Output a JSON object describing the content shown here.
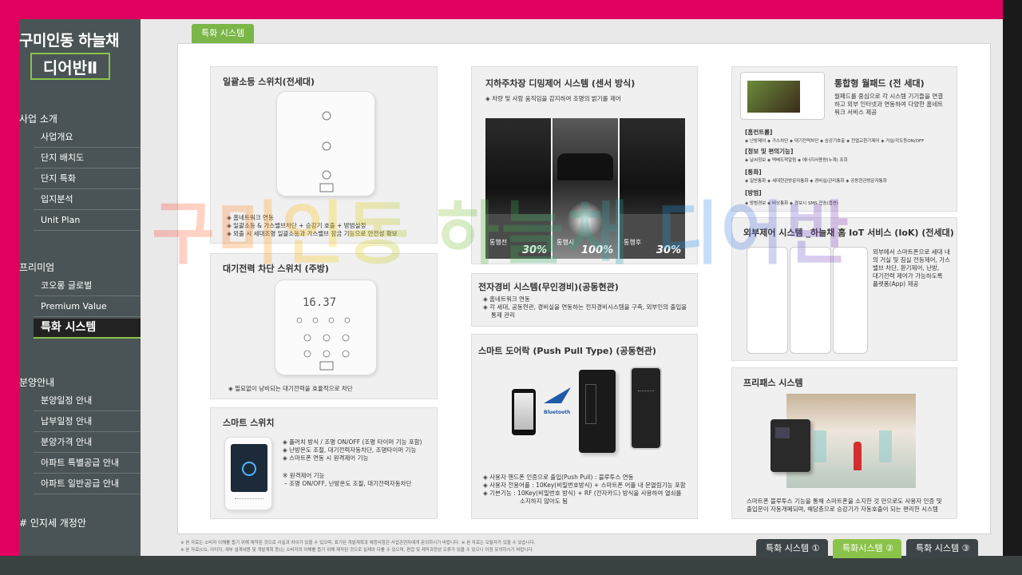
{
  "sidebar": {
    "brand_title": "구미인동 하늘채",
    "brand_sub": "디어반Ⅱ",
    "sections": [
      {
        "title": "사업 소개",
        "items": [
          "사업개요",
          "단지 배치도",
          "단지 특화",
          "입지분석",
          "Unit Plan"
        ]
      },
      {
        "title": "프리미엄",
        "items": [
          "코오롱 글로벌",
          "Premium Value",
          "특화 시스템"
        ]
      },
      {
        "title": "분양안내",
        "items": [
          "분양일정 안내",
          "납부일정 안내",
          "분양가격 안내",
          "아파트 특별공급 안내",
          "아파트 일반공급 안내"
        ]
      },
      {
        "title": "# 인지세 개정안",
        "items": []
      }
    ]
  },
  "tab": {
    "label": "특화 시스템"
  },
  "panels": {
    "light_switch": {
      "title": "일괄소등 스위치(전세대)",
      "lines": [
        "◈ 홈네트워크 연동",
        "◈ 일괄소등 & 가스밸브차단 + 승강기 호출 + 방범설정",
        "◈ 외출 시 세대조명 일괄소등과 가스밸브 잠금 기능으로 안전성 확보"
      ]
    },
    "standby_switch": {
      "title": "대기전력 차단 스위치 (주방)",
      "display": "16.37",
      "lines": [
        "◈ 필요없이 낭비되는 대기전력을 효율적으로 차단"
      ]
    },
    "smart_switch": {
      "title": "스마트 스위치",
      "lines": [
        "◈ 플러치 방식 / 조명 ON/OFF (조명 타이머 기능 포함)",
        "◈ 난방온도 조절, 대기전력자동차단, 조명타이머 기능",
        "◈ 스마트폰 연동 시 원격제어 기능",
        "※ 원격제어 기능",
        "– 조명 ON/OFF, 난방온도 조절, 대기전력자동차단"
      ]
    },
    "parking": {
      "title": "지하주차장 디밍제어 시스템 (센서 방식)",
      "desc": "◈ 차량 및 사람 움직임을 감지하여 조명의 밝기를 제어",
      "images": [
        {
          "label": "통행전",
          "pct": "30%"
        },
        {
          "label": "통행시",
          "pct": "100%"
        },
        {
          "label": "통행후",
          "pct": "30%"
        }
      ]
    },
    "security": {
      "title": "전자경비 시스템(무인경비)(공동현관)",
      "lines": [
        "◈ 홈네트워크 연동",
        "◈ 각 세대, 공동현관, 경비실을 연동하는 전자경비시스템을 구축, 외부인의 출입을",
        "통제 관리"
      ]
    },
    "door_lock": {
      "title": "스마트 도어락 (Push Pull Type) (공동현관)",
      "bluetooth": "Bluetooth",
      "lines": [
        "◈ 사용자 핸드폰 인증으로 출입(Push Pull) : 블루투스 연동",
        "◈ 사용자 전용어플 : 10Key(비밀번호방식) + 스마트폰 어플 내 문열림기능 포함",
        "◈ 기본기능 : 10Key(비밀번호 방식) + RF (전자카드) 방식을 사용하여 열쇠를",
        "소지하지 않아도 됨"
      ]
    },
    "wallpad": {
      "title": "통합형 월패드 (전 세대)",
      "desc": [
        "월패드를 중심으로 각 시스템 기기들을 연결",
        "하고 외부 인터넷과 연동하여 다양한 홈네트",
        "워크 서비스 제공"
      ],
      "groups": [
        {
          "head": "[홈컨트롤]",
          "text": "◈ 난방제어 ◈ 가스차단 ◈ 대기전력차단 ◈ 승강기호출 ◈ 전열교환기제어 ◈ 거실/각도등ON/OFF"
        },
        {
          "head": "[정보 및 편의기능]",
          "text": "◈ 날씨정보 ◈ 택배도착알림 ◈ 에너지사용량(누계) 조회"
        },
        {
          "head": "[통화]",
          "text": "◈ 일반통화 ◈ 세대현관방문자통화 ◈ 경비실/관리통화 ◈ 공동현관방문자통화"
        },
        {
          "head": "[방범]",
          "text": "◈ 방범경보 ◈ 비상통화 ◈ 경보시 SMS 전송(옵션)"
        }
      ]
    },
    "iot": {
      "title": "외부제어 시스템 _하늘채 홈 IoT 서비스 (IoK) (전세대)",
      "desc": [
        "외부에서 스마트폰으로 세대 내",
        "의 거실 및 침실 전등제어, 가스",
        "밸브 차단, 환기제어, 난방,",
        "대기전력 제어가 가능하도록",
        "플랫폼(App) 제공"
      ]
    },
    "free_pass": {
      "title": "프리패스 시스템",
      "lines": [
        "스마트폰 블루투스 기능을 통해 스마트폰을 소지한 것 만으로도 사용자 인증 및",
        "출입문이 자동개폐되며, 해당층으로 승강기가 자동호출이 되는 편리한 시스템"
      ]
    }
  },
  "footnotes": [
    "※ 본 자료는 소비자 이해를 돕기 위해 제작된 것으로 사실과 차이가 있을 수 있으며, 표기된 개발계획과 예정사항은 사업관련자에게 문의하시기 바랍니다.   ※ 본 자료는 오탈자가 있을 수 있습니다.",
    "※ 본 자료(CG, 이미지, 세부 설계내용 및 개발계획 등)는 소비자의 이해를 돕기 위해 제작된 것으로 실제와 다를 수 있으며, 편집 및 제작과정상 오류가 있을 수 있으니 이점 유의하시기 바랍니다."
  ],
  "bottom_tabs": [
    "특화 시스템 ①",
    "특화시스템 ②",
    "특화 시스템 ③"
  ],
  "watermark": "구미인동 하늘채 디어반 2차",
  "colors": {
    "frame": "#e0005e",
    "accent": "#7ab648",
    "sidebar": "#4a5456",
    "active_tab": "#8bc34a",
    "dark_tab": "#3c4447"
  }
}
